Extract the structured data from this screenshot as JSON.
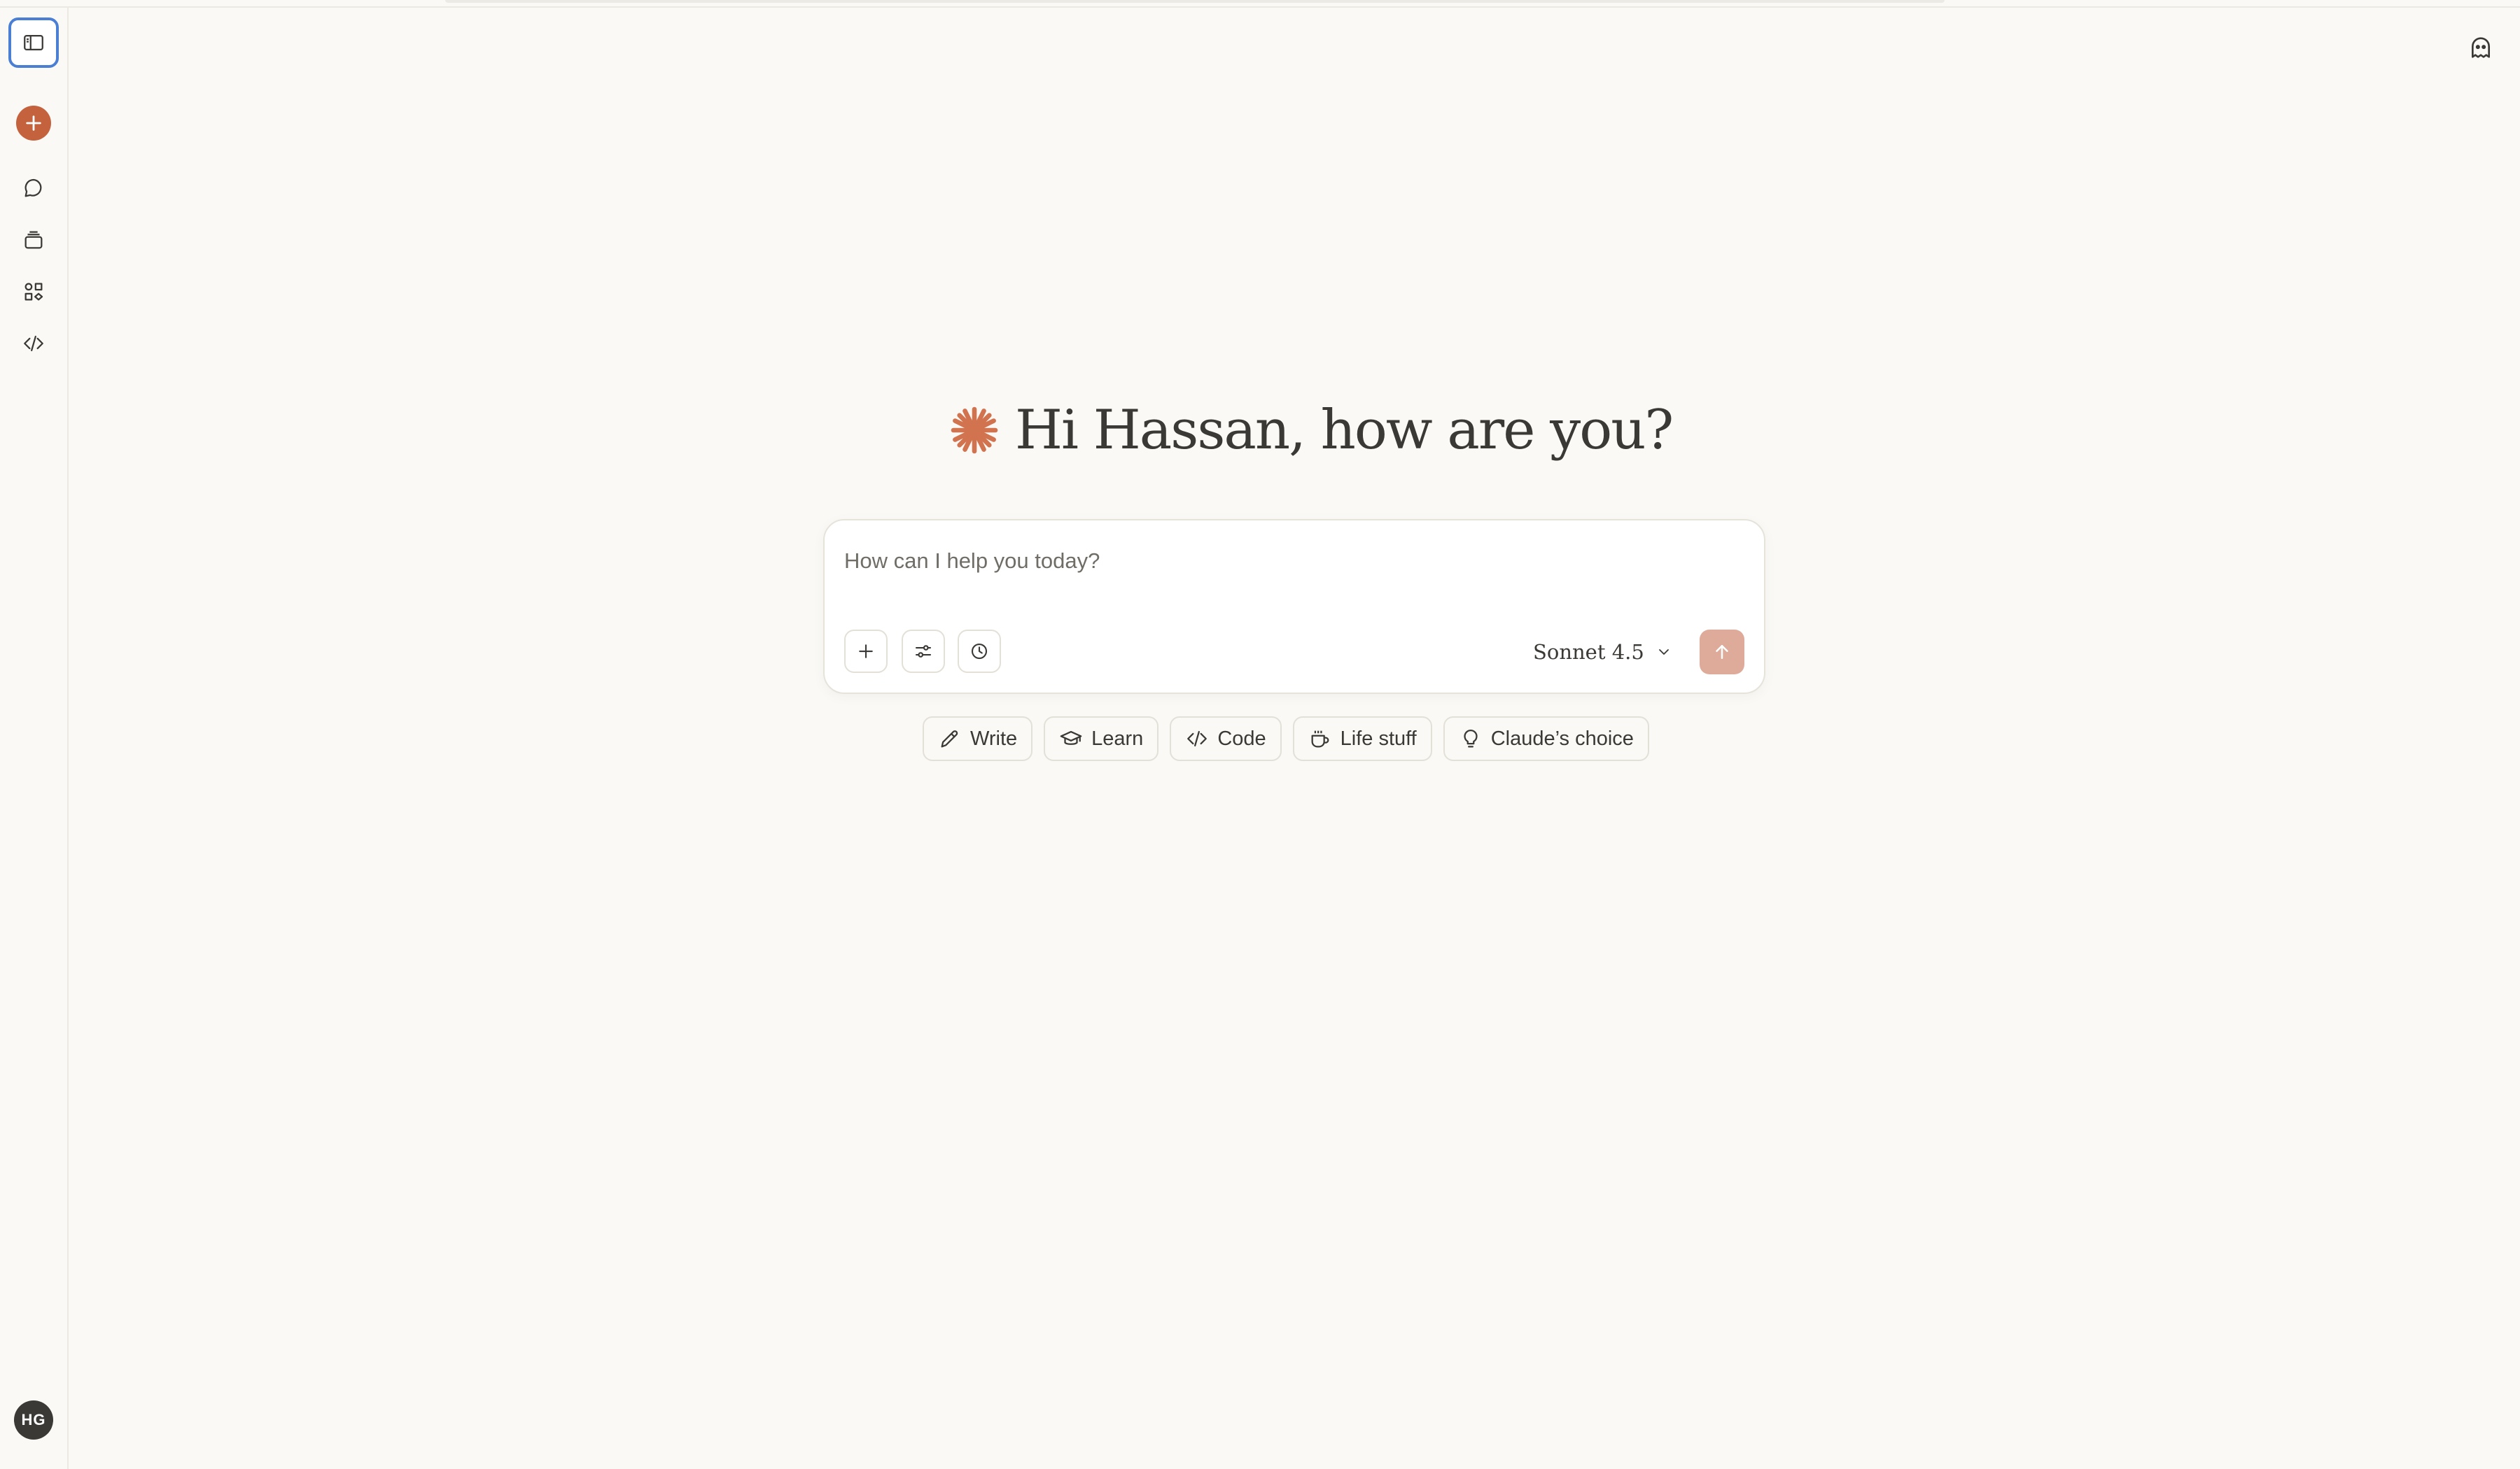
{
  "greeting": {
    "text": "Hi Hassan, how are you?"
  },
  "composer": {
    "placeholder": "How can I help you today?",
    "model": "Sonnet 4.5"
  },
  "chips": [
    {
      "label": "Write",
      "icon": "pencil-icon"
    },
    {
      "label": "Learn",
      "icon": "graduation-cap-icon"
    },
    {
      "label": "Code",
      "icon": "code-icon"
    },
    {
      "label": "Life stuff",
      "icon": "coffee-cup-icon"
    },
    {
      "label": "Claude’s choice",
      "icon": "lightbulb-icon"
    }
  ],
  "user": {
    "initials": "HG"
  },
  "colors": {
    "accent": "#c4623e",
    "send_disabled": "#deaa99",
    "background": "#faf9f5",
    "focus_ring": "#4a7fd4"
  }
}
